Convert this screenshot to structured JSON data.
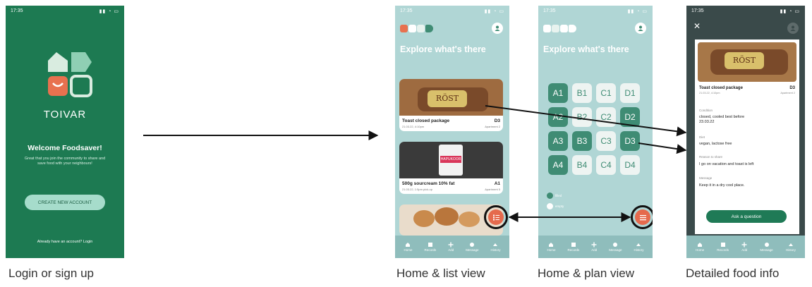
{
  "status": {
    "time": "17:35"
  },
  "login": {
    "brand": "TOIVAR",
    "welcome": "Welcome Foodsaver!",
    "blurb": "Great that you join the community to share and save food with your neighbours!",
    "create_button": "CREATE NEW ACCOUNT",
    "login_link": "Already have an account? Login"
  },
  "home_list": {
    "heading": "Explore what's there",
    "cards": [
      {
        "title": "Toast closed package",
        "code": "D3",
        "date": "21.03.22, 4:10pm",
        "apartment": "Apartment 2"
      },
      {
        "title": "500g sourcream 10% fat",
        "code": "A1",
        "date": "21.03.22, 1:5pm pick-up",
        "apartment": "Apartment 5"
      }
    ],
    "bread_brand": "RÖST",
    "sourcream_brand": "HAPUKOOR"
  },
  "home_plan": {
    "heading": "Explore what's there",
    "cells": [
      {
        "label": "A1",
        "state": "full"
      },
      {
        "label": "B1",
        "state": "empty"
      },
      {
        "label": "C1",
        "state": "empty"
      },
      {
        "label": "D1",
        "state": "empty"
      },
      {
        "label": "A2",
        "state": "full"
      },
      {
        "label": "B2",
        "state": "empty"
      },
      {
        "label": "C2",
        "state": "empty"
      },
      {
        "label": "D2",
        "state": "full"
      },
      {
        "label": "A3",
        "state": "full"
      },
      {
        "label": "B3",
        "state": "full"
      },
      {
        "label": "C3",
        "state": "empty"
      },
      {
        "label": "D3",
        "state": "full"
      },
      {
        "label": "A4",
        "state": "full"
      },
      {
        "label": "B4",
        "state": "empty"
      },
      {
        "label": "C4",
        "state": "empty"
      },
      {
        "label": "D4",
        "state": "empty"
      }
    ],
    "legend_filled": "filled",
    "legend_empty": "empty"
  },
  "detail": {
    "title": "Toast closed package",
    "code": "D3",
    "date": "21.03.22, 4:10pm",
    "apartment": "Apartment 2",
    "bread_brand": "RÖST",
    "condition_label": "Condition",
    "condition_value": "closed, cooled best before 23.03.22",
    "diet_label": "Diet",
    "diet_value": "vegan, lactose free",
    "reason_label": "Reason to share",
    "reason_value": "I go on vacation and toast is left",
    "message_label": "Message",
    "message_value": "Keep it in a dry cool place.",
    "ask_button": "Ask a question"
  },
  "nav": [
    "Home",
    "Records",
    "Add",
    "Message",
    "History"
  ],
  "captions": [
    "Login or sign up",
    "Home & list view",
    "Home & plan view",
    "Detailed food info"
  ],
  "colors": {
    "brand_green": "#1d7a52",
    "teal_bg": "#b0d6d5",
    "plan_full": "#3f8c74",
    "fab_orange": "#e56a4d"
  }
}
